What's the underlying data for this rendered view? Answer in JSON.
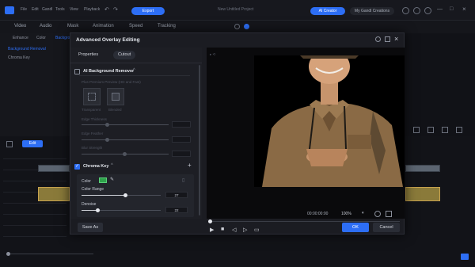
{
  "menubar": {
    "items": [
      "File",
      "Edit",
      "Gandl",
      "Tools",
      "View",
      "Playback"
    ],
    "export_label": "Export",
    "project_title": "New Untitled Project",
    "ai_creator_label": "AI Creator",
    "account_label": "My Gandl Creations"
  },
  "tabs": [
    "Video",
    "Audio",
    "Mask",
    "Animation",
    "Speed",
    "Tracking"
  ],
  "left_panel": {
    "tabs": [
      "Enhance",
      "Color",
      "Background"
    ],
    "items": [
      "Background Removal",
      "Chroma Key"
    ]
  },
  "dialog": {
    "title": "Advanced Overlay Editing",
    "subtabs": [
      "Properties",
      "Cutout"
    ],
    "active_subtab": "Cutout",
    "ai_bg_remover": {
      "label": "AI Background Remover",
      "enabled": false,
      "hint": "Plus Premium Preview (HD and Fast)",
      "options": [
        "Transparent",
        "Blended"
      ],
      "sliders": [
        "Edge Thickness",
        "Edge Feather",
        "Blur Strength"
      ]
    },
    "chroma_key": {
      "label": "Chroma Key",
      "enabled": true,
      "color_label": "Color",
      "key_color": "#2fa34b",
      "color_range_label": "Color Range",
      "color_range_value": "27",
      "color_range_level": 0.55,
      "denoise_label": "Denoise",
      "denoise_value": "22",
      "denoise_level": 0.2
    },
    "preview": {
      "timecode": "00:00:00:00",
      "zoom": "100%"
    },
    "save_as_label": "Save As",
    "ok_label": "OK",
    "cancel_label": "Cancel"
  },
  "timeline": {
    "edit_label": "Edit"
  },
  "colors": {
    "accent": "#2d6ef5",
    "key_green": "#2fa34b"
  }
}
